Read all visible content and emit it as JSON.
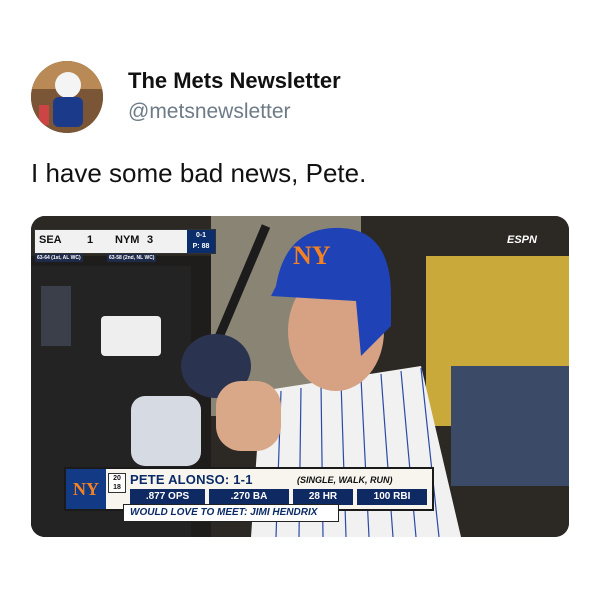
{
  "tweet": {
    "display_name": "The Mets Newsletter",
    "handle": "@metsnewsletter",
    "text": "I have some bad news, Pete."
  },
  "broadcast": {
    "network": "ESPN",
    "away": {
      "abbr": "SEA",
      "score": "1",
      "record": "63-64 (1st, AL WC)"
    },
    "home": {
      "abbr": "NYM",
      "score": "3",
      "record": "63-58 (2nd, NL WC)"
    },
    "count": "0-1",
    "pitch_count": "P: 88",
    "helmet_logo": "NY"
  },
  "lower_third": {
    "team_logo": "NY",
    "jersey_number": "20",
    "jersey_alt": "18",
    "player_line": "PETE ALONSO: 1-1",
    "result": "(SINGLE, WALK, RUN)",
    "stats": [
      ".877 OPS",
      ".270 BA",
      "28 HR",
      "100 RBI"
    ],
    "banner": "WOULD LOVE TO MEET: JIMI HENDRIX"
  }
}
